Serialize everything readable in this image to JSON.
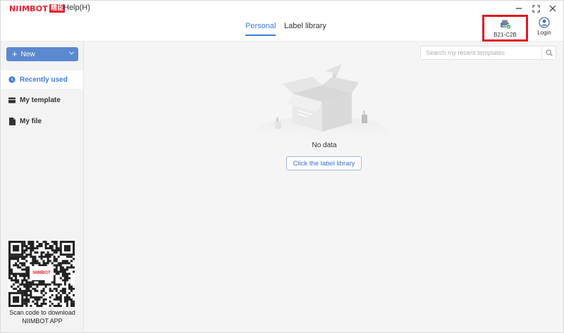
{
  "titlebar": {
    "logo_text": "NIIMBOT",
    "logo_cn": "精臣",
    "help_menu": "Help(H)",
    "minimize": "−",
    "maximize": "⛶",
    "close": "✕"
  },
  "header": {
    "tabs": [
      {
        "label": "Personal",
        "active": true
      },
      {
        "label": "Label library",
        "active": false
      }
    ],
    "printer": {
      "label": "B21-C2B",
      "status_color": "#3bb54a"
    },
    "login": {
      "label": "Login"
    }
  },
  "sidebar": {
    "new_button": "New",
    "items": [
      {
        "label": "Recently used",
        "icon": "clock-icon",
        "active": true
      },
      {
        "label": "My template",
        "icon": "template-icon",
        "active": false
      },
      {
        "label": "My file",
        "icon": "file-icon",
        "active": false
      }
    ],
    "qr_logo": "NIIMBOT",
    "qr_caption_line1": "Scan code to download",
    "qr_caption_line2": "NIIMBOT APP"
  },
  "main": {
    "search_placeholder": "Search my recent templates",
    "empty_text": "No data",
    "library_button": "Click the label library"
  },
  "colors": {
    "accent": "#3d7ce0",
    "new_button": "#5b88cf",
    "brand": "#e8202a",
    "highlight": "#e3161c"
  }
}
